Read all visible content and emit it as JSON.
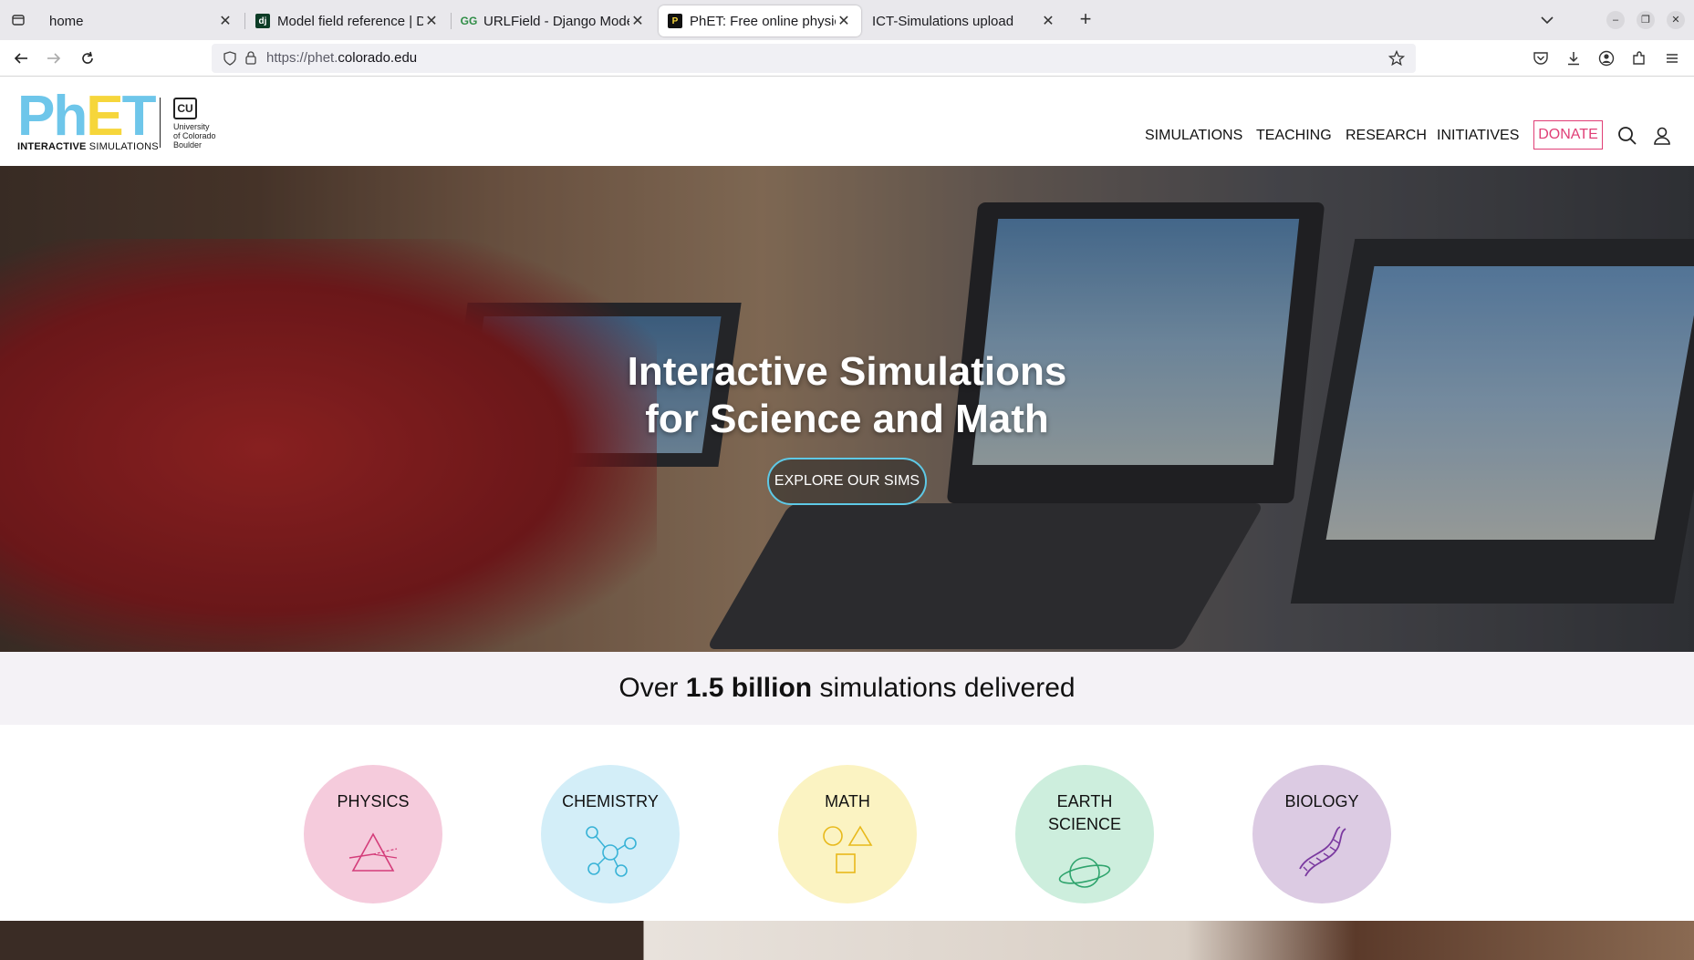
{
  "browser": {
    "tabs": [
      {
        "title": "home",
        "active": false
      },
      {
        "title": "Model field reference | Django",
        "active": false
      },
      {
        "title": "URLField - Django Models",
        "active": false
      },
      {
        "title": "PhET: Free online physics",
        "active": true
      },
      {
        "title": "ICT-Simulations upload",
        "active": false
      }
    ],
    "url_prefix": "https://phet.",
    "url_host": "colorado.edu"
  },
  "site": {
    "logo_sub_bold": "INTERACTIVE",
    "logo_sub_rest": " SIMULATIONS",
    "cu_lines": [
      "University",
      "of Colorado",
      "Boulder"
    ],
    "menu": [
      "SIMULATIONS",
      "TEACHING",
      "RESEARCH",
      "INITIATIVES"
    ],
    "donate": "DONATE"
  },
  "hero": {
    "title_line1": "Interactive Simulations",
    "title_line2": "for Science and Math",
    "cta": "EXPLORE OUR SIMS"
  },
  "stats": {
    "prefix": "Over ",
    "highlight": "1.5 billion",
    "suffix": " simulations delivered"
  },
  "categories": [
    {
      "label": "PHYSICS",
      "color": "#f5cbdc",
      "icon": "prism-icon"
    },
    {
      "label": "CHEMISTRY",
      "color": "#d3eef8",
      "icon": "molecule-icon"
    },
    {
      "label": "MATH",
      "color": "#fbf3c2",
      "icon": "shapes-icon"
    },
    {
      "label": "EARTH",
      "label2": "SCIENCE",
      "color": "#cdeedd",
      "icon": "planet-icon"
    },
    {
      "label": "BIOLOGY",
      "color": "#dccbe3",
      "icon": "dna-icon"
    }
  ]
}
